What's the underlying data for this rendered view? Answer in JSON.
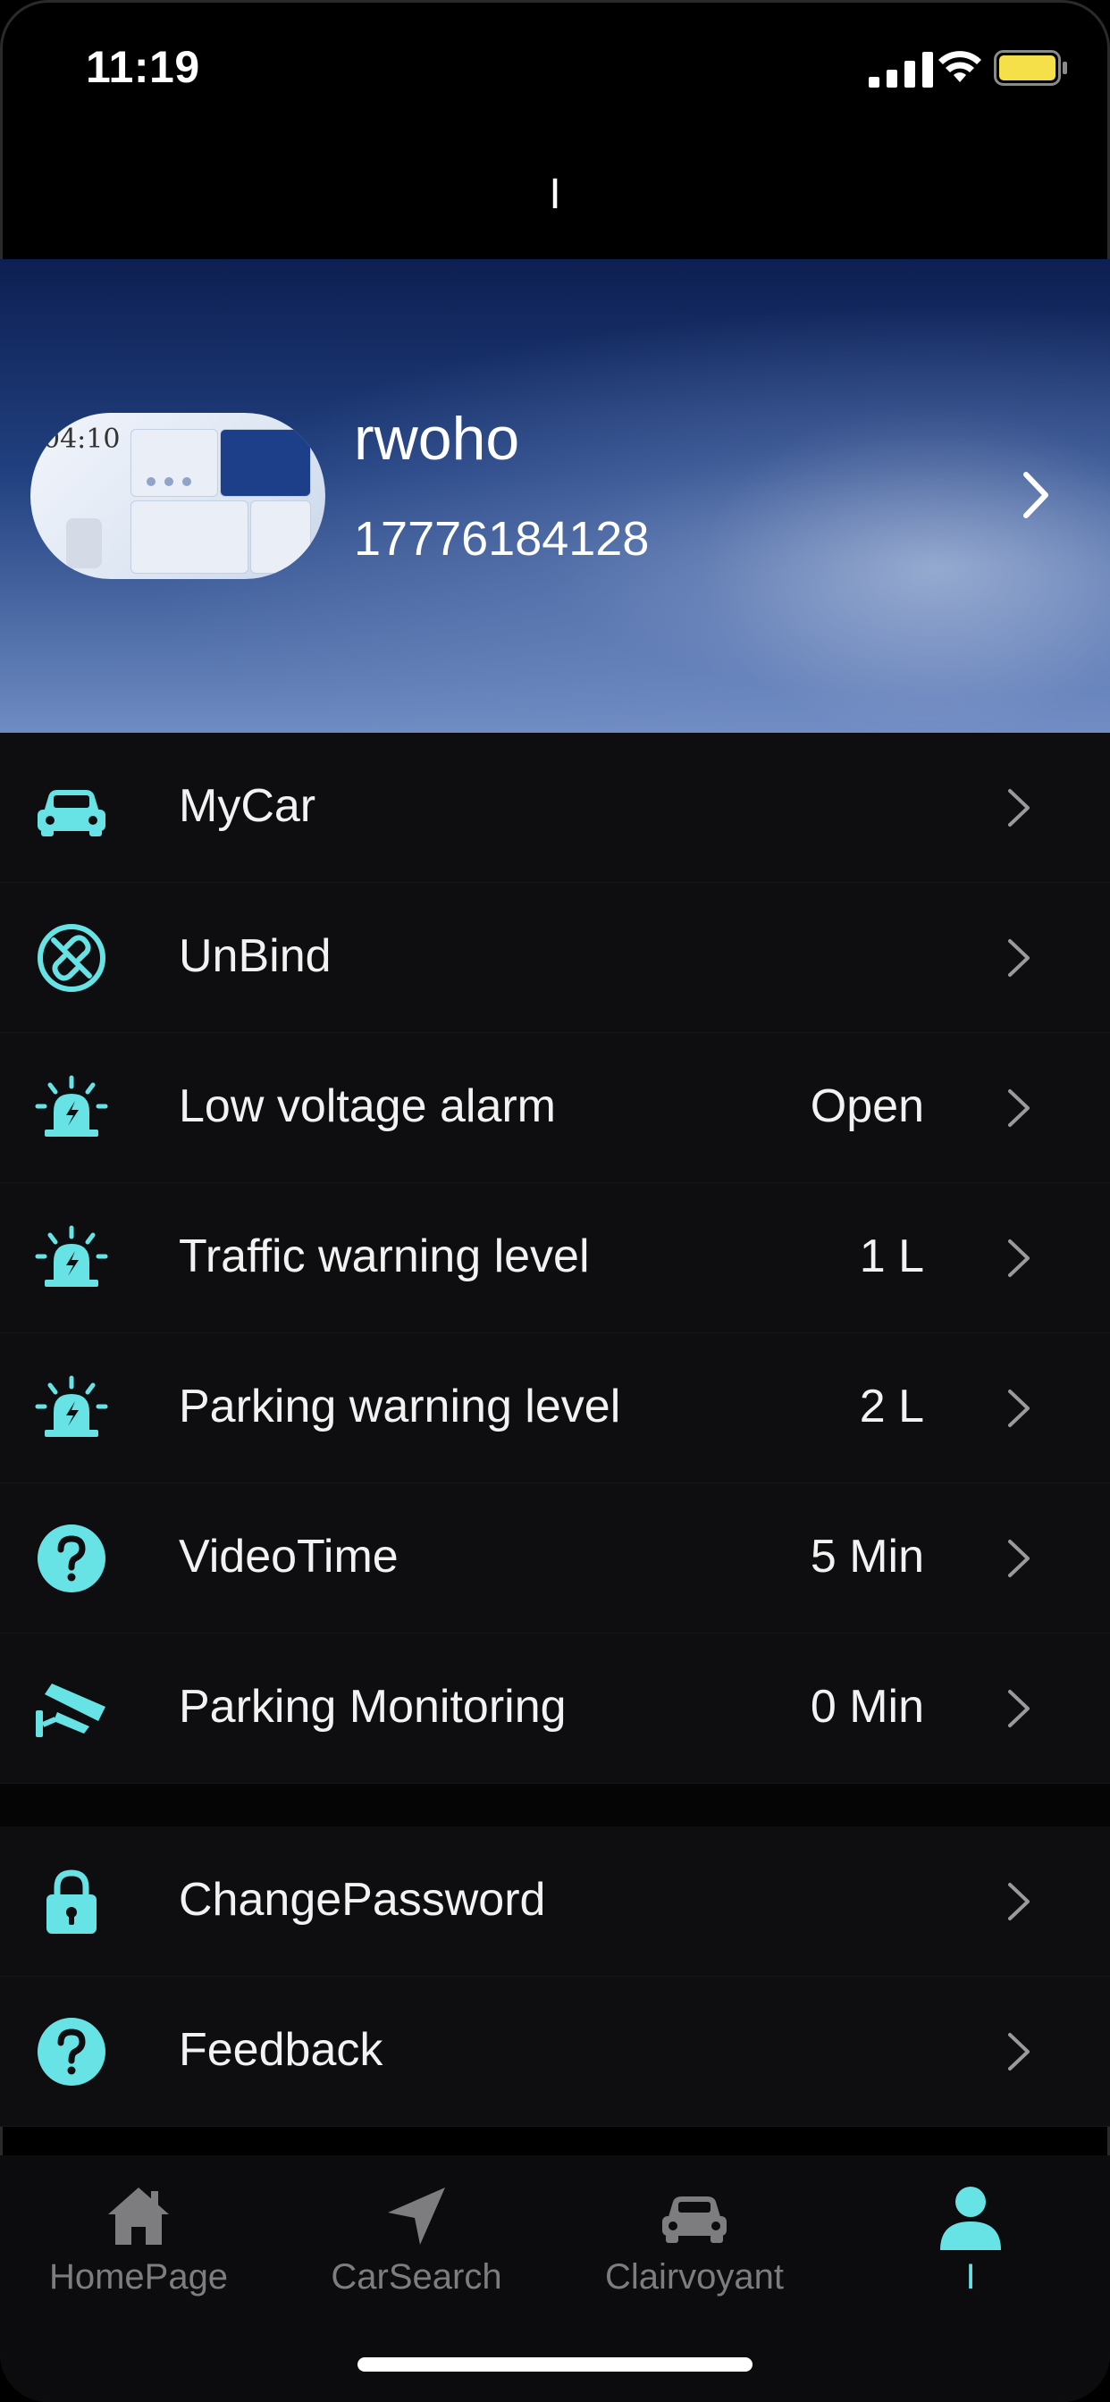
{
  "status_bar": {
    "time": "11:19"
  },
  "nav": {
    "title": "I"
  },
  "profile": {
    "avatar_clock_text": "04:10",
    "username": "rwoho",
    "phone": "17776184128"
  },
  "settings": {
    "items": [
      {
        "label": "MyCar",
        "value": ""
      },
      {
        "label": "UnBind",
        "value": ""
      },
      {
        "label": "Low voltage alarm",
        "value": "Open"
      },
      {
        "label": "Traffic warning level",
        "value": "1 L"
      },
      {
        "label": "Parking warning level",
        "value": "2 L"
      },
      {
        "label": "VideoTime",
        "value": "5 Min"
      },
      {
        "label": "Parking Monitoring",
        "value": "0 Min"
      }
    ],
    "account_items": [
      {
        "label": "ChangePassword"
      },
      {
        "label": "Feedback"
      }
    ]
  },
  "tabbar": {
    "tabs": [
      {
        "label": "HomePage",
        "icon": "home-icon"
      },
      {
        "label": "CarSearch",
        "icon": "navigation-arrow-icon"
      },
      {
        "label": "Clairvoyant",
        "icon": "car-icon"
      },
      {
        "label": "I",
        "icon": "person-icon",
        "active": true
      }
    ]
  },
  "colors": {
    "accent": "#67e3e6",
    "background": "#000000",
    "row_background": "#0e0e10",
    "tab_inactive": "#7d7d80",
    "battery": "#f5e04a"
  }
}
